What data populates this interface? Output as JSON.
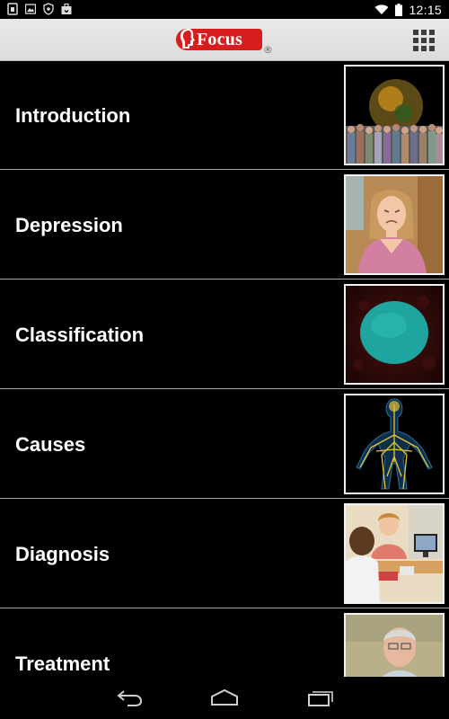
{
  "status_bar": {
    "time": "12:15",
    "left_icons": [
      "sim-card-icon",
      "image-icon",
      "shield-icon",
      "briefcase-icon"
    ],
    "right_icons": [
      "wifi-icon",
      "battery-icon"
    ]
  },
  "header": {
    "logo_text": "Focus",
    "registered_mark": "®",
    "menu_icon": "grid-menu-icon"
  },
  "chapters": [
    {
      "label": "Introduction",
      "thumbnail": "crowd-and-globe-image"
    },
    {
      "label": "Depression",
      "thumbnail": "sad-woman-image"
    },
    {
      "label": "Classification",
      "thumbnail": "teal-cell-image"
    },
    {
      "label": "Causes",
      "thumbnail": "nervous-system-image"
    },
    {
      "label": "Diagnosis",
      "thumbnail": "doctor-consultation-image"
    },
    {
      "label": "Treatment",
      "thumbnail": "elderly-man-image"
    }
  ],
  "nav_bar": {
    "buttons": [
      "back-icon",
      "home-icon",
      "recent-apps-icon"
    ]
  },
  "colors": {
    "logo_red": "#d71d1d",
    "header_bg": "#e2e2e2",
    "list_bg": "#000000",
    "divider": "#a9a9a9"
  }
}
